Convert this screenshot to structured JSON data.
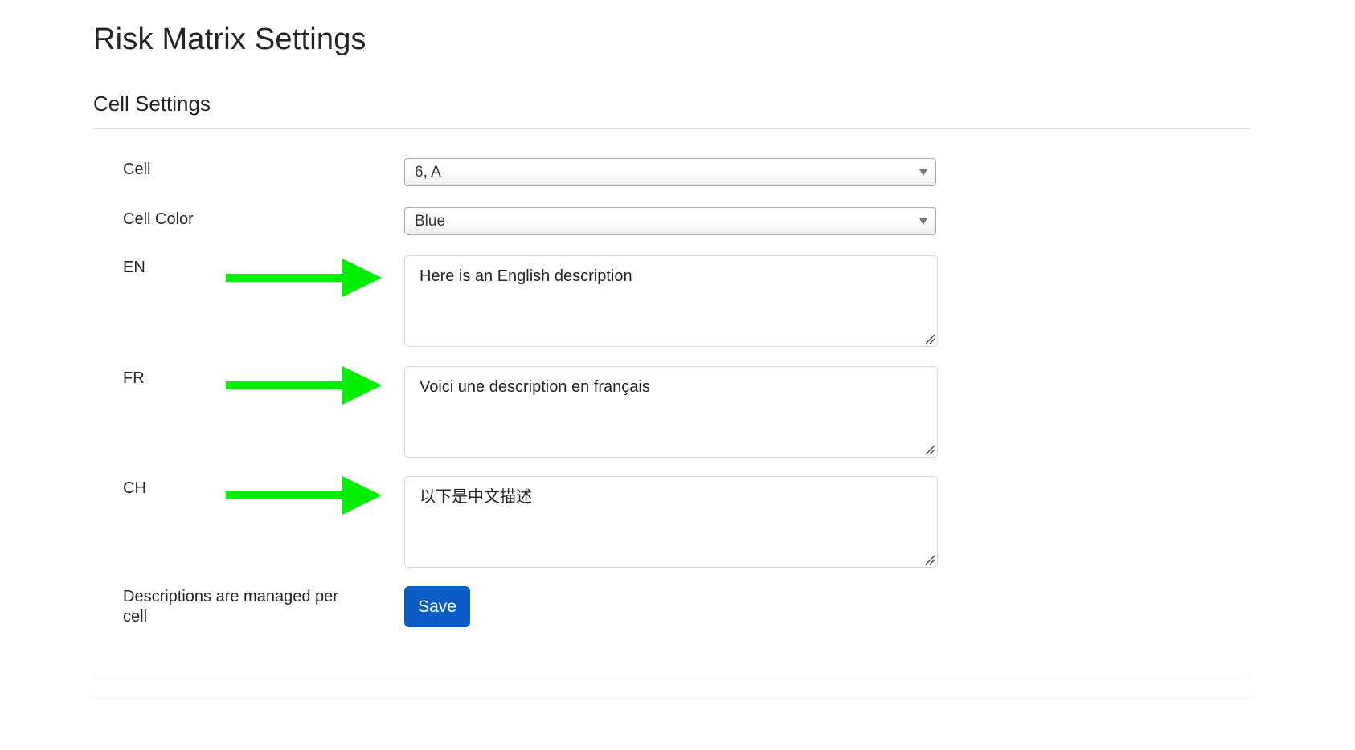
{
  "page": {
    "title": "Risk Matrix Settings"
  },
  "section": {
    "title": "Cell Settings"
  },
  "form": {
    "cell": {
      "label": "Cell",
      "value": "6, A"
    },
    "cell_color": {
      "label": "Cell Color",
      "value": "Blue"
    },
    "en": {
      "label": "EN",
      "value": "Here is an English description"
    },
    "fr": {
      "label": "FR",
      "value": "Voici une description en français"
    },
    "ch": {
      "label": "CH",
      "value": "以下是中文描述"
    },
    "note": "Descriptions are managed per cell",
    "save_label": "Save"
  },
  "annotations": {
    "arrow_color": "#00ee00",
    "arrow_icon": "right-arrow-icon"
  },
  "colors": {
    "primary_button": "#0b5cc4",
    "divider": "#dcdcdc"
  }
}
